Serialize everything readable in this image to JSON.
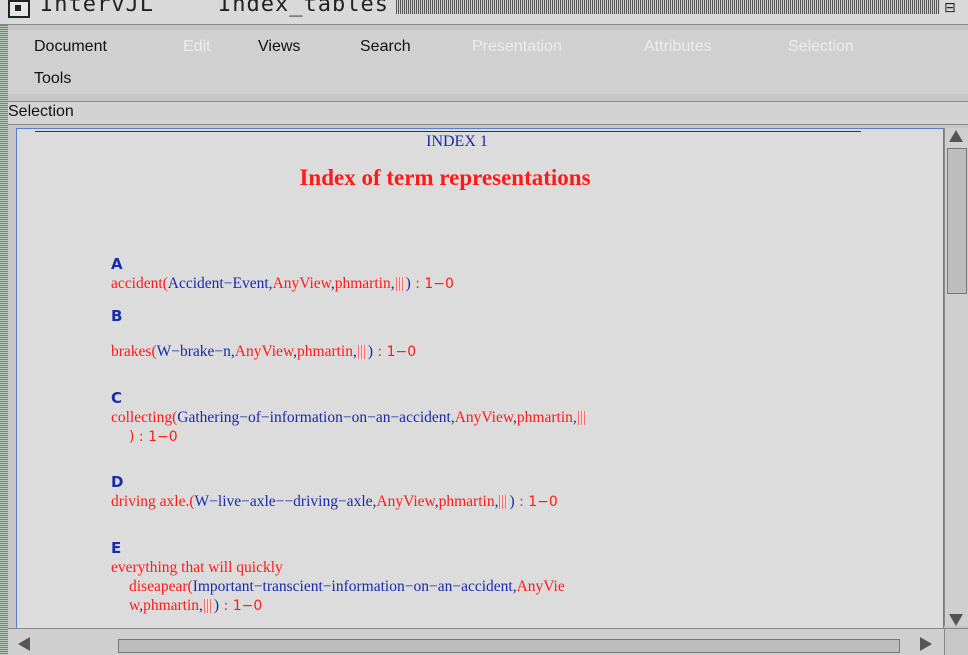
{
  "window": {
    "app_title": "IntervJL",
    "doc_title": "Index_tables",
    "corner_glyph": "⊟"
  },
  "menubar": {
    "items": [
      {
        "label": "Document",
        "enabled": true
      },
      {
        "label": "Edit",
        "enabled": false
      },
      {
        "label": "Views",
        "enabled": true
      },
      {
        "label": "Search",
        "enabled": true
      },
      {
        "label": "Presentation",
        "enabled": false
      },
      {
        "label": "Attributes",
        "enabled": false
      },
      {
        "label": "Selection",
        "enabled": false
      },
      {
        "label": "Tools",
        "enabled": true
      }
    ]
  },
  "selection_bar": {
    "label": "Selection"
  },
  "document": {
    "index_label": "INDEX 1",
    "title": "Index of term representations",
    "sections": [
      {
        "letter": "A",
        "term": "accident(",
        "concept": "Accident−Event",
        "view": "AnyView",
        "user": "phmartin",
        "count": " : 1−0"
      },
      {
        "letter": "B",
        "term": "brakes(",
        "concept": "W−brake−n",
        "view": "AnyView",
        "user": "phmartin",
        "count": " : 1−0"
      },
      {
        "letter": "C",
        "term": "collecting(",
        "concept": "Gathering−of−information−on−an−accident",
        "view": "AnyView",
        "user": "phmartin",
        "count": ") : 1−0"
      },
      {
        "letter": "D",
        "term": "driving axle.(",
        "concept": "W−live−axle−−driving−axle",
        "view": "AnyView",
        "user": "phmartin",
        "count": " : 1−0"
      },
      {
        "letter": "E",
        "term_line1": "everything that will quickly",
        "term": "diseapear(",
        "concept": "Important−transcient−information−on−an−accident",
        "view_part1": "AnyVie",
        "view_part2": "w",
        "user": "phmartin",
        "count": " : 1−0"
      }
    ]
  },
  "colors": {
    "term": "#ff1a1a",
    "concept": "#1a2aa8",
    "background": "#dcdcdc"
  }
}
